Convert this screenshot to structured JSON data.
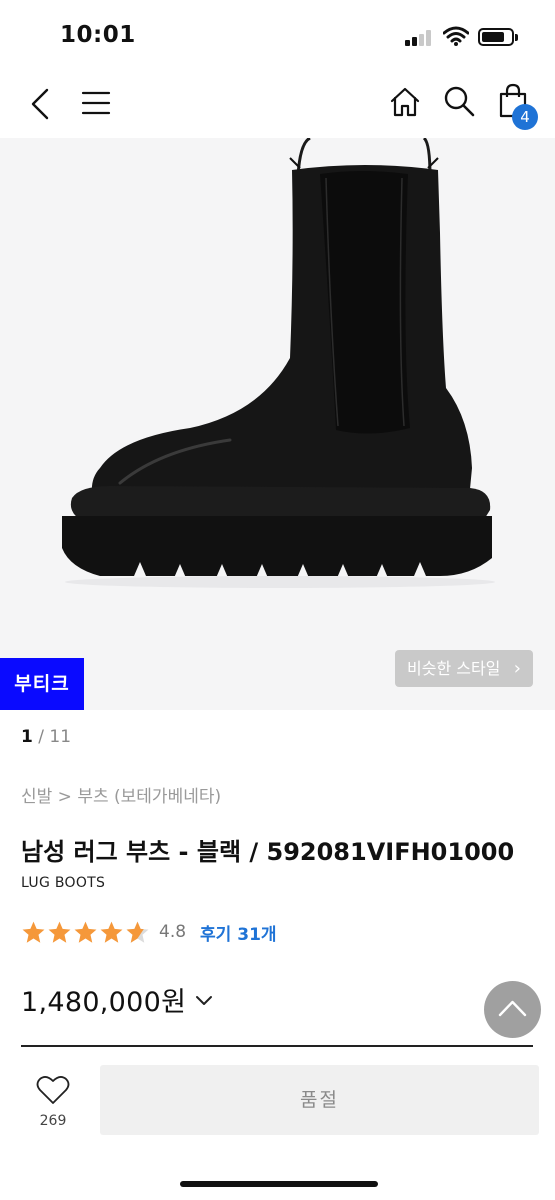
{
  "status_bar": {
    "time": "10:01"
  },
  "header": {
    "icons": [
      "back-icon",
      "menu-icon",
      "home-icon",
      "search-icon",
      "shopping-bag-icon"
    ],
    "cart_count": "4"
  },
  "gallery": {
    "boutique_label": "부티크",
    "similar_style_label": "비슷한 스타일",
    "similar_style_chevron": "›",
    "current_index": "1",
    "separator": " / ",
    "total": "11"
  },
  "product": {
    "breadcrumb": "신발 > 부츠 (보테가베네타)",
    "title": "남성 러그 부츠 - 블랙 / 592081VIFH01000",
    "subtitle": "LUG BOOTS",
    "rating": "4.8",
    "rating_stars": 4.5,
    "reviews_label": "후기 31개",
    "price": "1,480,000원"
  },
  "bottom_bar": {
    "wish_count": "269",
    "soldout_label": "품절"
  },
  "colors": {
    "accent_blue": "#1f73d6",
    "boutique_blue": "#0a0aff",
    "star_orange": "#f5983a"
  }
}
